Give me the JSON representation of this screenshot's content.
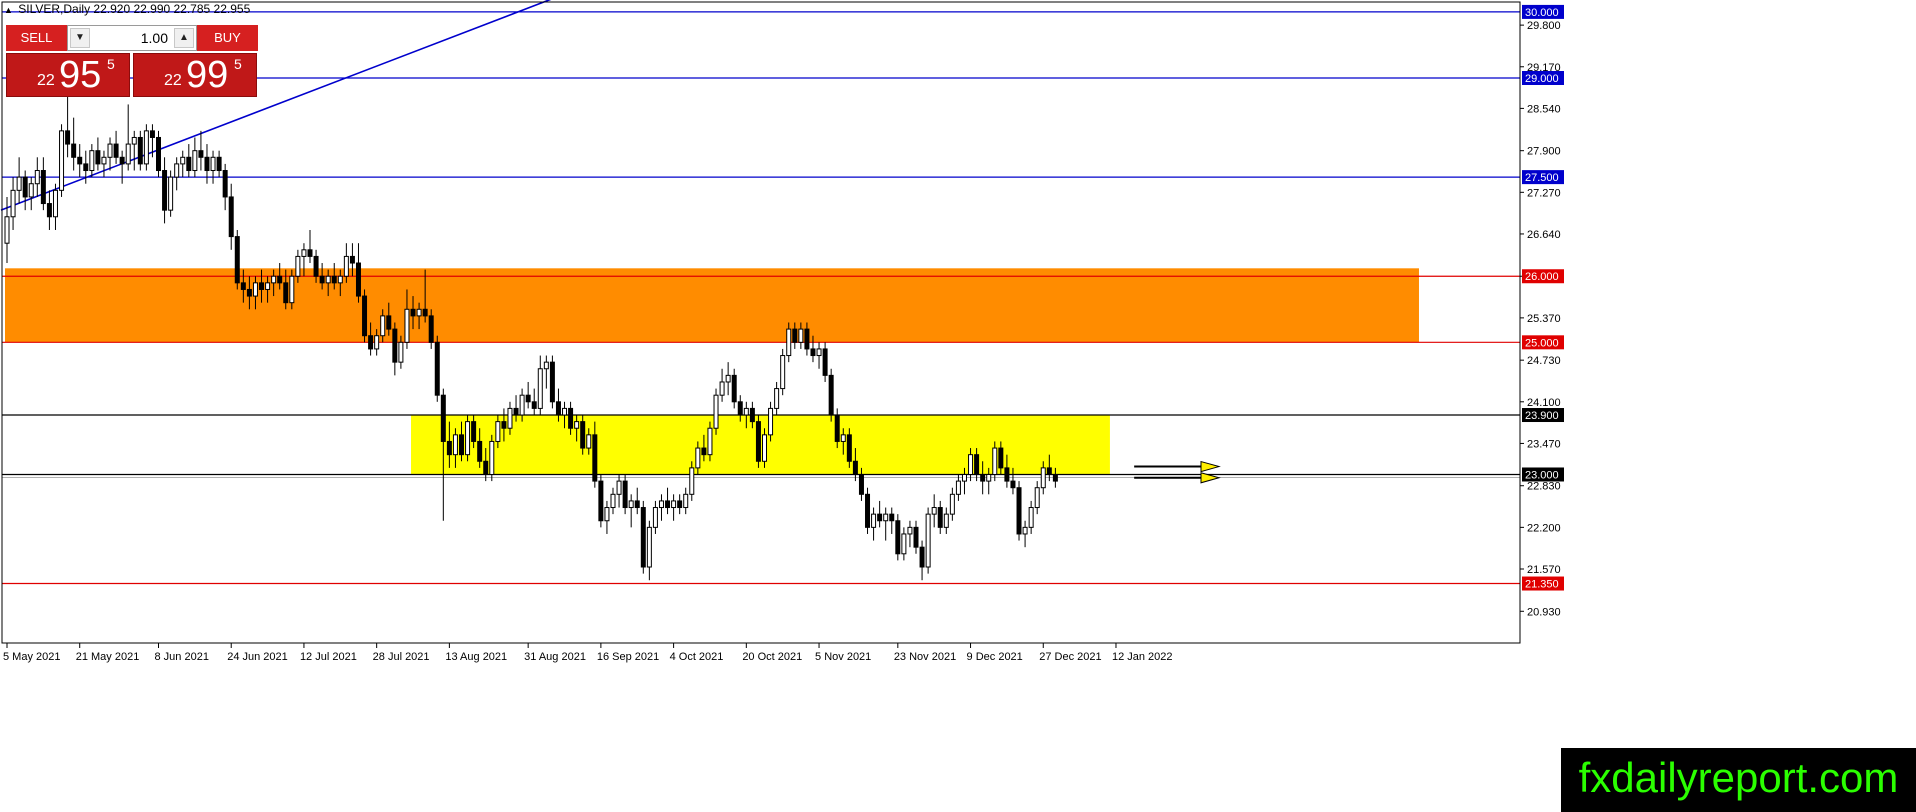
{
  "header": {
    "symbol_text": "SILVER,Daily",
    "ohlc_text": "22.920 22.990 22.785 22.955"
  },
  "trade_panel": {
    "sell_label": "SELL",
    "buy_label": "BUY",
    "lot_value": "1.00",
    "sell_price_prefix": "22",
    "sell_price_main": "95",
    "sell_price_sup": "5",
    "buy_price_prefix": "22",
    "buy_price_main": "99",
    "buy_price_sup": "5"
  },
  "brand_text": "fxdailyreport.com",
  "colors": {
    "bull_candle": "#ffffff",
    "bear_candle": "#000000",
    "resistance_zone": "#ff8c00",
    "range_zone": "#ffff00",
    "blue_line": "#0000cc",
    "red_line": "#e00000",
    "brand_text": "#2bff00"
  },
  "chart_data": {
    "type": "candlestick",
    "title": "SILVER,Daily",
    "ylim": [
      20.45,
      30.15
    ],
    "y_ticks": [
      "29.800",
      "29.170",
      "28.540",
      "27.900",
      "27.270",
      "26.640",
      "26.000",
      "25.370",
      "24.730",
      "24.100",
      "23.470",
      "22.830",
      "22.200",
      "21.570",
      "20.930"
    ],
    "x_tick_labels": [
      "5 May 2021",
      "21 May 2021",
      "8 Jun 2021",
      "24 Jun 2021",
      "12 Jul 2021",
      "28 Jul 2021",
      "13 Aug 2021",
      "31 Aug 2021",
      "16 Sep 2021",
      "4 Oct 2021",
      "20 Oct 2021",
      "5 Nov 2021",
      "23 Nov 2021",
      "9 Dec 2021",
      "27 Dec 2021",
      "12 Jan 2022"
    ],
    "x_tick_index": [
      0,
      12,
      25,
      37,
      49,
      61,
      73,
      86,
      98,
      110,
      122,
      134,
      147,
      159,
      171,
      183
    ],
    "horizontal_levels": [
      {
        "value": 30.0,
        "label": "30.000",
        "color": "#0000cc"
      },
      {
        "value": 29.0,
        "label": "29.000",
        "color": "#0000cc"
      },
      {
        "value": 27.5,
        "label": "27.500",
        "color": "#0000cc"
      },
      {
        "value": 26.0,
        "label": "26.000",
        "color": "#e00000"
      },
      {
        "value": 25.0,
        "label": "25.000",
        "color": "#e00000"
      },
      {
        "value": 23.9,
        "label": "23.900",
        "color": "#000000"
      },
      {
        "value": 23.0,
        "label": "23.000",
        "color": "#000000"
      },
      {
        "value": 21.35,
        "label": "21.350",
        "color": "#e00000"
      }
    ],
    "zones": [
      {
        "name": "orange",
        "y_from": 25.0,
        "y_to": 26.12,
        "x_from_index": 0,
        "x_to_index": 233,
        "color": "#ff8c00"
      },
      {
        "name": "yellow",
        "y_from": 23.0,
        "y_to": 23.9,
        "x_from_index": 67,
        "x_to_index": 182,
        "color": "#ffff00"
      }
    ],
    "trendline": {
      "from_index": 0,
      "from_value": 27.0,
      "to_index": 90,
      "to_value": 30.2,
      "color": "#0000cc"
    },
    "arrows": [
      {
        "from_index": 186,
        "to_index": 200,
        "value": 23.12
      },
      {
        "from_index": 186,
        "to_index": 200,
        "value": 22.95
      }
    ],
    "candles": [
      [
        26.5,
        27.2,
        26.2,
        26.9
      ],
      [
        26.9,
        27.5,
        26.7,
        27.3
      ],
      [
        27.3,
        27.8,
        27.1,
        27.5
      ],
      [
        27.5,
        27.6,
        27.0,
        27.2
      ],
      [
        27.2,
        27.5,
        27.0,
        27.4
      ],
      [
        27.4,
        27.8,
        27.2,
        27.6
      ],
      [
        27.6,
        27.8,
        27.0,
        27.1
      ],
      [
        27.1,
        27.3,
        26.7,
        26.9
      ],
      [
        26.9,
        27.4,
        26.7,
        27.3
      ],
      [
        27.3,
        28.3,
        27.2,
        28.2
      ],
      [
        28.2,
        28.8,
        27.8,
        28.0
      ],
      [
        28.0,
        28.4,
        27.6,
        27.8
      ],
      [
        27.8,
        28.0,
        27.5,
        27.7
      ],
      [
        27.7,
        27.9,
        27.4,
        27.6
      ],
      [
        27.6,
        28.0,
        27.5,
        27.9
      ],
      [
        27.9,
        28.1,
        27.6,
        27.7
      ],
      [
        27.7,
        27.9,
        27.5,
        27.8
      ],
      [
        27.8,
        28.1,
        27.6,
        28.0
      ],
      [
        28.0,
        28.2,
        27.7,
        27.8
      ],
      [
        27.8,
        27.9,
        27.4,
        27.7
      ],
      [
        27.7,
        28.6,
        27.6,
        28.0
      ],
      [
        28.0,
        28.2,
        27.6,
        28.1
      ],
      [
        28.1,
        28.2,
        27.6,
        27.7
      ],
      [
        27.7,
        28.3,
        27.6,
        28.2
      ],
      [
        28.2,
        28.3,
        27.8,
        28.1
      ],
      [
        28.1,
        28.2,
        27.5,
        27.6
      ],
      [
        27.6,
        27.8,
        26.8,
        27.0
      ],
      [
        27.0,
        27.6,
        26.9,
        27.5
      ],
      [
        27.5,
        27.8,
        27.3,
        27.7
      ],
      [
        27.7,
        27.9,
        27.5,
        27.8
      ],
      [
        27.8,
        28.0,
        27.5,
        27.6
      ],
      [
        27.6,
        28.1,
        27.5,
        27.9
      ],
      [
        27.9,
        28.2,
        27.6,
        27.8
      ],
      [
        27.8,
        28.0,
        27.4,
        27.6
      ],
      [
        27.6,
        27.9,
        27.4,
        27.8
      ],
      [
        27.8,
        27.9,
        27.5,
        27.6
      ],
      [
        27.6,
        27.7,
        27.0,
        27.2
      ],
      [
        27.2,
        27.4,
        26.4,
        26.6
      ],
      [
        26.6,
        26.7,
        25.8,
        25.9
      ],
      [
        25.9,
        26.1,
        25.6,
        25.8
      ],
      [
        25.8,
        26.0,
        25.5,
        25.7
      ],
      [
        25.7,
        26.0,
        25.5,
        25.9
      ],
      [
        25.9,
        26.1,
        25.6,
        25.8
      ],
      [
        25.8,
        26.0,
        25.6,
        25.9
      ],
      [
        25.9,
        26.1,
        25.7,
        26.0
      ],
      [
        26.0,
        26.2,
        25.8,
        25.9
      ],
      [
        25.9,
        26.1,
        25.5,
        25.6
      ],
      [
        25.6,
        26.1,
        25.5,
        26.0
      ],
      [
        26.0,
        26.4,
        25.9,
        26.3
      ],
      [
        26.3,
        26.5,
        26.0,
        26.4
      ],
      [
        26.4,
        26.7,
        26.2,
        26.3
      ],
      [
        26.3,
        26.4,
        25.9,
        26.0
      ],
      [
        26.0,
        26.2,
        25.8,
        25.9
      ],
      [
        25.9,
        26.1,
        25.7,
        26.0
      ],
      [
        26.0,
        26.2,
        25.8,
        25.9
      ],
      [
        25.9,
        26.1,
        25.7,
        26.0
      ],
      [
        26.0,
        26.5,
        25.9,
        26.3
      ],
      [
        26.3,
        26.5,
        26.0,
        26.2
      ],
      [
        26.2,
        26.5,
        25.6,
        25.7
      ],
      [
        25.7,
        25.8,
        25.0,
        25.1
      ],
      [
        25.1,
        25.3,
        24.8,
        24.9
      ],
      [
        24.9,
        25.2,
        24.8,
        25.1
      ],
      [
        25.1,
        25.5,
        25.0,
        25.4
      ],
      [
        25.4,
        25.6,
        25.1,
        25.2
      ],
      [
        25.2,
        25.3,
        24.5,
        24.7
      ],
      [
        24.7,
        25.1,
        24.6,
        25.0
      ],
      [
        25.0,
        25.8,
        24.9,
        25.5
      ],
      [
        25.5,
        25.7,
        25.2,
        25.4
      ],
      [
        25.4,
        25.6,
        25.2,
        25.5
      ],
      [
        25.5,
        26.1,
        25.3,
        25.4
      ],
      [
        25.4,
        25.5,
        24.9,
        25.0
      ],
      [
        25.0,
        25.1,
        24.1,
        24.2
      ],
      [
        24.2,
        24.3,
        22.3,
        23.5
      ],
      [
        23.5,
        23.8,
        23.1,
        23.3
      ],
      [
        23.3,
        23.7,
        23.1,
        23.6
      ],
      [
        23.6,
        23.8,
        23.2,
        23.3
      ],
      [
        23.3,
        23.9,
        23.2,
        23.8
      ],
      [
        23.8,
        23.9,
        23.4,
        23.5
      ],
      [
        23.5,
        23.7,
        23.1,
        23.2
      ],
      [
        23.2,
        23.4,
        22.9,
        23.0
      ],
      [
        23.0,
        23.6,
        22.9,
        23.5
      ],
      [
        23.5,
        23.9,
        23.4,
        23.8
      ],
      [
        23.8,
        24.0,
        23.5,
        23.7
      ],
      [
        23.7,
        24.1,
        23.6,
        24.0
      ],
      [
        24.0,
        24.2,
        23.8,
        23.9
      ],
      [
        23.9,
        24.3,
        23.8,
        24.2
      ],
      [
        24.2,
        24.4,
        24.0,
        24.1
      ],
      [
        24.1,
        24.3,
        23.9,
        24.0
      ],
      [
        24.0,
        24.8,
        23.9,
        24.6
      ],
      [
        24.6,
        24.8,
        24.3,
        24.7
      ],
      [
        24.7,
        24.8,
        24.0,
        24.1
      ],
      [
        24.1,
        24.3,
        23.8,
        23.9
      ],
      [
        23.9,
        24.1,
        23.7,
        24.0
      ],
      [
        24.0,
        24.1,
        23.6,
        23.7
      ],
      [
        23.7,
        23.9,
        23.5,
        23.8
      ],
      [
        23.8,
        23.9,
        23.3,
        23.4
      ],
      [
        23.4,
        23.7,
        23.3,
        23.6
      ],
      [
        23.6,
        23.8,
        22.8,
        22.9
      ],
      [
        22.9,
        23.0,
        22.2,
        22.3
      ],
      [
        22.3,
        22.6,
        22.1,
        22.5
      ],
      [
        22.5,
        22.8,
        22.4,
        22.7
      ],
      [
        22.7,
        23.0,
        22.5,
        22.9
      ],
      [
        22.9,
        23.0,
        22.4,
        22.5
      ],
      [
        22.5,
        22.7,
        22.2,
        22.6
      ],
      [
        22.6,
        22.8,
        22.4,
        22.5
      ],
      [
        22.5,
        22.6,
        21.5,
        21.6
      ],
      [
        21.6,
        22.3,
        21.4,
        22.2
      ],
      [
        22.2,
        22.6,
        22.1,
        22.5
      ],
      [
        22.5,
        22.7,
        22.3,
        22.6
      ],
      [
        22.6,
        22.8,
        22.4,
        22.5
      ],
      [
        22.5,
        22.7,
        22.3,
        22.6
      ],
      [
        22.6,
        22.7,
        22.4,
        22.5
      ],
      [
        22.5,
        22.8,
        22.4,
        22.7
      ],
      [
        22.7,
        23.2,
        22.6,
        23.1
      ],
      [
        23.1,
        23.5,
        23.0,
        23.4
      ],
      [
        23.4,
        23.6,
        23.2,
        23.3
      ],
      [
        23.3,
        23.8,
        23.2,
        23.7
      ],
      [
        23.7,
        24.3,
        23.6,
        24.2
      ],
      [
        24.2,
        24.6,
        24.1,
        24.4
      ],
      [
        24.4,
        24.7,
        24.2,
        24.5
      ],
      [
        24.5,
        24.6,
        24.0,
        24.1
      ],
      [
        24.1,
        24.2,
        23.8,
        23.9
      ],
      [
        23.9,
        24.1,
        23.7,
        24.0
      ],
      [
        24.0,
        24.1,
        23.7,
        23.8
      ],
      [
        23.8,
        23.9,
        23.1,
        23.2
      ],
      [
        23.2,
        23.7,
        23.1,
        23.6
      ],
      [
        23.6,
        24.1,
        23.5,
        24.0
      ],
      [
        24.0,
        24.4,
        23.9,
        24.3
      ],
      [
        24.3,
        24.9,
        24.2,
        24.8
      ],
      [
        24.8,
        25.3,
        24.7,
        25.2
      ],
      [
        25.2,
        25.3,
        24.9,
        25.0
      ],
      [
        25.0,
        25.3,
        24.9,
        25.2
      ],
      [
        25.2,
        25.3,
        24.8,
        24.9
      ],
      [
        24.9,
        25.1,
        24.7,
        24.8
      ],
      [
        24.8,
        25.0,
        24.6,
        24.9
      ],
      [
        24.9,
        25.0,
        24.4,
        24.5
      ],
      [
        24.5,
        24.6,
        23.8,
        23.9
      ],
      [
        23.9,
        24.0,
        23.4,
        23.5
      ],
      [
        23.5,
        23.7,
        23.3,
        23.6
      ],
      [
        23.6,
        23.7,
        23.1,
        23.2
      ],
      [
        23.2,
        23.4,
        22.9,
        23.0
      ],
      [
        23.0,
        23.1,
        22.6,
        22.7
      ],
      [
        22.7,
        22.8,
        22.1,
        22.2
      ],
      [
        22.2,
        22.5,
        22.0,
        22.4
      ],
      [
        22.4,
        22.6,
        22.2,
        22.3
      ],
      [
        22.3,
        22.5,
        22.0,
        22.4
      ],
      [
        22.4,
        22.5,
        22.1,
        22.3
      ],
      [
        22.3,
        22.4,
        21.7,
        21.8
      ],
      [
        21.8,
        22.2,
        21.7,
        22.1
      ],
      [
        22.1,
        22.3,
        21.9,
        22.2
      ],
      [
        22.2,
        22.3,
        21.8,
        21.9
      ],
      [
        21.9,
        22.0,
        21.4,
        21.6
      ],
      [
        21.6,
        22.5,
        21.5,
        22.4
      ],
      [
        22.4,
        22.7,
        22.2,
        22.5
      ],
      [
        22.5,
        22.6,
        22.1,
        22.2
      ],
      [
        22.2,
        22.5,
        22.1,
        22.4
      ],
      [
        22.4,
        22.8,
        22.3,
        22.7
      ],
      [
        22.7,
        23.0,
        22.6,
        22.9
      ],
      [
        22.9,
        23.1,
        22.7,
        23.0
      ],
      [
        23.0,
        23.4,
        22.9,
        23.3
      ],
      [
        23.3,
        23.4,
        22.9,
        23.0
      ],
      [
        23.0,
        23.2,
        22.7,
        22.9
      ],
      [
        22.9,
        23.1,
        22.7,
        23.0
      ],
      [
        23.0,
        23.5,
        22.9,
        23.4
      ],
      [
        23.4,
        23.5,
        23.0,
        23.1
      ],
      [
        23.1,
        23.3,
        22.8,
        22.9
      ],
      [
        22.9,
        23.1,
        22.7,
        22.8
      ],
      [
        22.8,
        22.9,
        22.0,
        22.1
      ],
      [
        22.1,
        22.3,
        21.9,
        22.2
      ],
      [
        22.2,
        22.6,
        22.1,
        22.5
      ],
      [
        22.5,
        22.9,
        22.4,
        22.8
      ],
      [
        22.8,
        23.2,
        22.7,
        23.1
      ],
      [
        23.1,
        23.3,
        22.9,
        23.0
      ],
      [
        23.0,
        23.1,
        22.8,
        22.9
      ]
    ]
  }
}
